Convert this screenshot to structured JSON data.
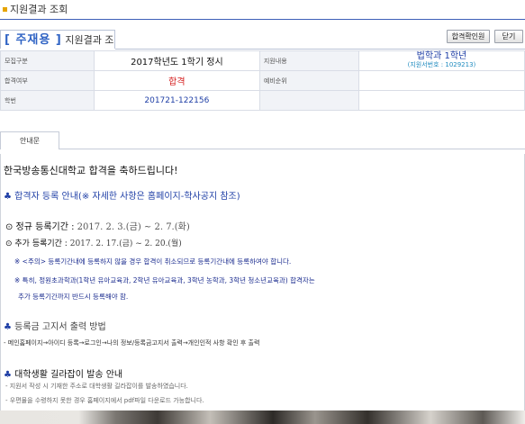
{
  "window": {
    "title": "지원결과 조회"
  },
  "header": {
    "main": "[ 주재용 ]",
    "sub": "지원결과 조회",
    "buttons": {
      "confirm": "합격확인원",
      "close": "닫기"
    }
  },
  "info": {
    "rows": [
      {
        "label1": "모집구분",
        "value1": "2017학년도 1학기 정시",
        "label2": "지원내용",
        "value2": "법학과 1학년",
        "value2_sub": "(지원서번호 : 1029213)"
      },
      {
        "label1": "합격여부",
        "value1": "합격",
        "label2": "예비순위",
        "value2": ""
      },
      {
        "label1": "학번",
        "value1": "201721-122156",
        "label2": "",
        "value2": ""
      }
    ]
  },
  "tabs": [
    {
      "label": "안내문"
    }
  ],
  "notice": {
    "congrats": "한국방송통신대학교 합격을 축하드립니다!",
    "section1_marker": "♣",
    "section1": "합격자 등록 안내(※ 자세한 사항은 홈페이지-학사공지 참조)",
    "reg1_label": "⊙ 정규 등록기간 :",
    "reg1_date": "2017. 2. 3.(금) ~ 2. 7.(화)",
    "reg2_label": "⊙ 추가 등록기간 :",
    "reg2_date": "2017. 2. 17.(금) ~ 2. 20.(월)",
    "note1": "※ <주의> 등록기간내에 등록하지 않을 경우 합격이 취소되므로 등록기간내에 등록하여야 합니다.",
    "note2": "※ 특히, 정원초과학과(1학년 유아교육과, 2학년 유아교육과, 3학년 농학과, 3학년 청소년교육과) 합격자는",
    "note3": "추가 등록기간까지 반드시 등록해야 함.",
    "section2_marker": "♣",
    "section2": "등록금 고지서 출력 방법",
    "path": "- 메인홈페이지→아이디 등록→로그인→나의 정보/등록금고지서 출력→개인인적 사항 확인 후 출력",
    "section3_marker": "♣",
    "section3": "대학생활 길라잡이 발송 안내",
    "guide1": "- 지원서 작성 시 기재한 주소로 대학생활 길라잡이를 발송하였습니다.",
    "guide2": "- 우편물을 수령하지 못한 경우 홈페이지에서 pdf파일 다운로드 가능합니다."
  }
}
